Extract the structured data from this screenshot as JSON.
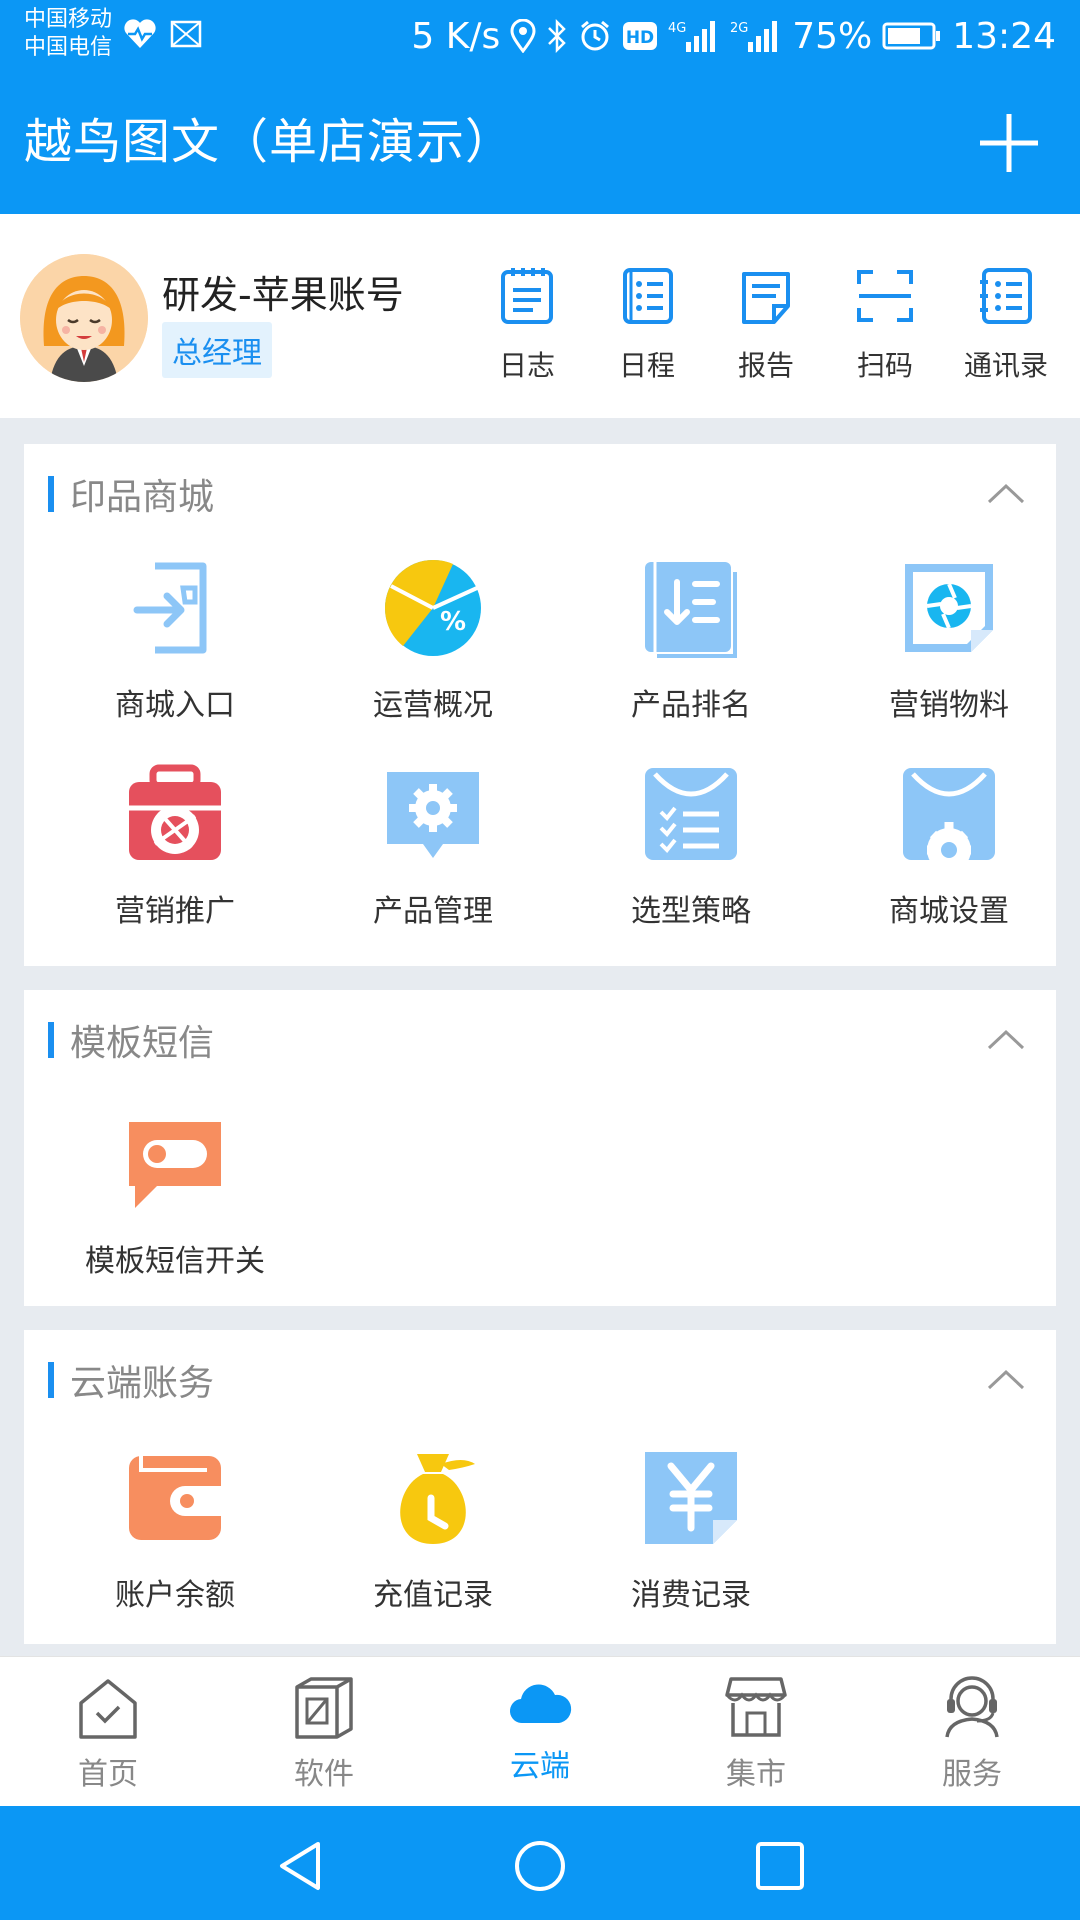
{
  "status_bar": {
    "carrier1": "中国移动",
    "carrier2": "中国电信",
    "speed": "5 K/s",
    "net1": "4G",
    "net2": "2G",
    "battery": "75%",
    "time": "13:24"
  },
  "header": {
    "title": "越鸟图文（单店演示）",
    "add_icon": "plus-icon"
  },
  "profile": {
    "name": "研发-苹果账号",
    "role": "总经理",
    "quick_actions": [
      {
        "label": "日志",
        "icon": "log-icon"
      },
      {
        "label": "日程",
        "icon": "schedule-icon"
      },
      {
        "label": "报告",
        "icon": "report-icon"
      },
      {
        "label": "扫码",
        "icon": "scan-icon"
      },
      {
        "label": "通讯录",
        "icon": "contacts-icon"
      }
    ]
  },
  "sections": [
    {
      "title": "印品商城",
      "items": [
        {
          "label": "商城入口",
          "icon": "mall-entry-icon"
        },
        {
          "label": "运营概况",
          "icon": "pie-percent-icon"
        },
        {
          "label": "产品排名",
          "icon": "product-rank-icon"
        },
        {
          "label": "营销物料",
          "icon": "marketing-material-icon"
        },
        {
          "label": "营销推广",
          "icon": "promotion-icon"
        },
        {
          "label": "产品管理",
          "icon": "product-manage-icon"
        },
        {
          "label": "选型策略",
          "icon": "selection-strategy-icon"
        },
        {
          "label": "商城设置",
          "icon": "mall-settings-icon"
        }
      ]
    },
    {
      "title": "模板短信",
      "items": [
        {
          "label": "模板短信开关",
          "icon": "sms-toggle-icon"
        }
      ]
    },
    {
      "title": "云端账务",
      "items": [
        {
          "label": "账户余额",
          "icon": "wallet-icon"
        },
        {
          "label": "充值记录",
          "icon": "money-bag-icon"
        },
        {
          "label": "消费记录",
          "icon": "yen-receipt-icon"
        }
      ]
    }
  ],
  "tab_bar": [
    {
      "label": "首页",
      "icon": "home-icon"
    },
    {
      "label": "软件",
      "icon": "software-icon"
    },
    {
      "label": "云端",
      "icon": "cloud-icon",
      "active": true
    },
    {
      "label": "集市",
      "icon": "market-icon"
    },
    {
      "label": "服务",
      "icon": "service-icon"
    }
  ],
  "colors": {
    "primary": "#0b97f5",
    "accent": "#1a8ff0"
  }
}
